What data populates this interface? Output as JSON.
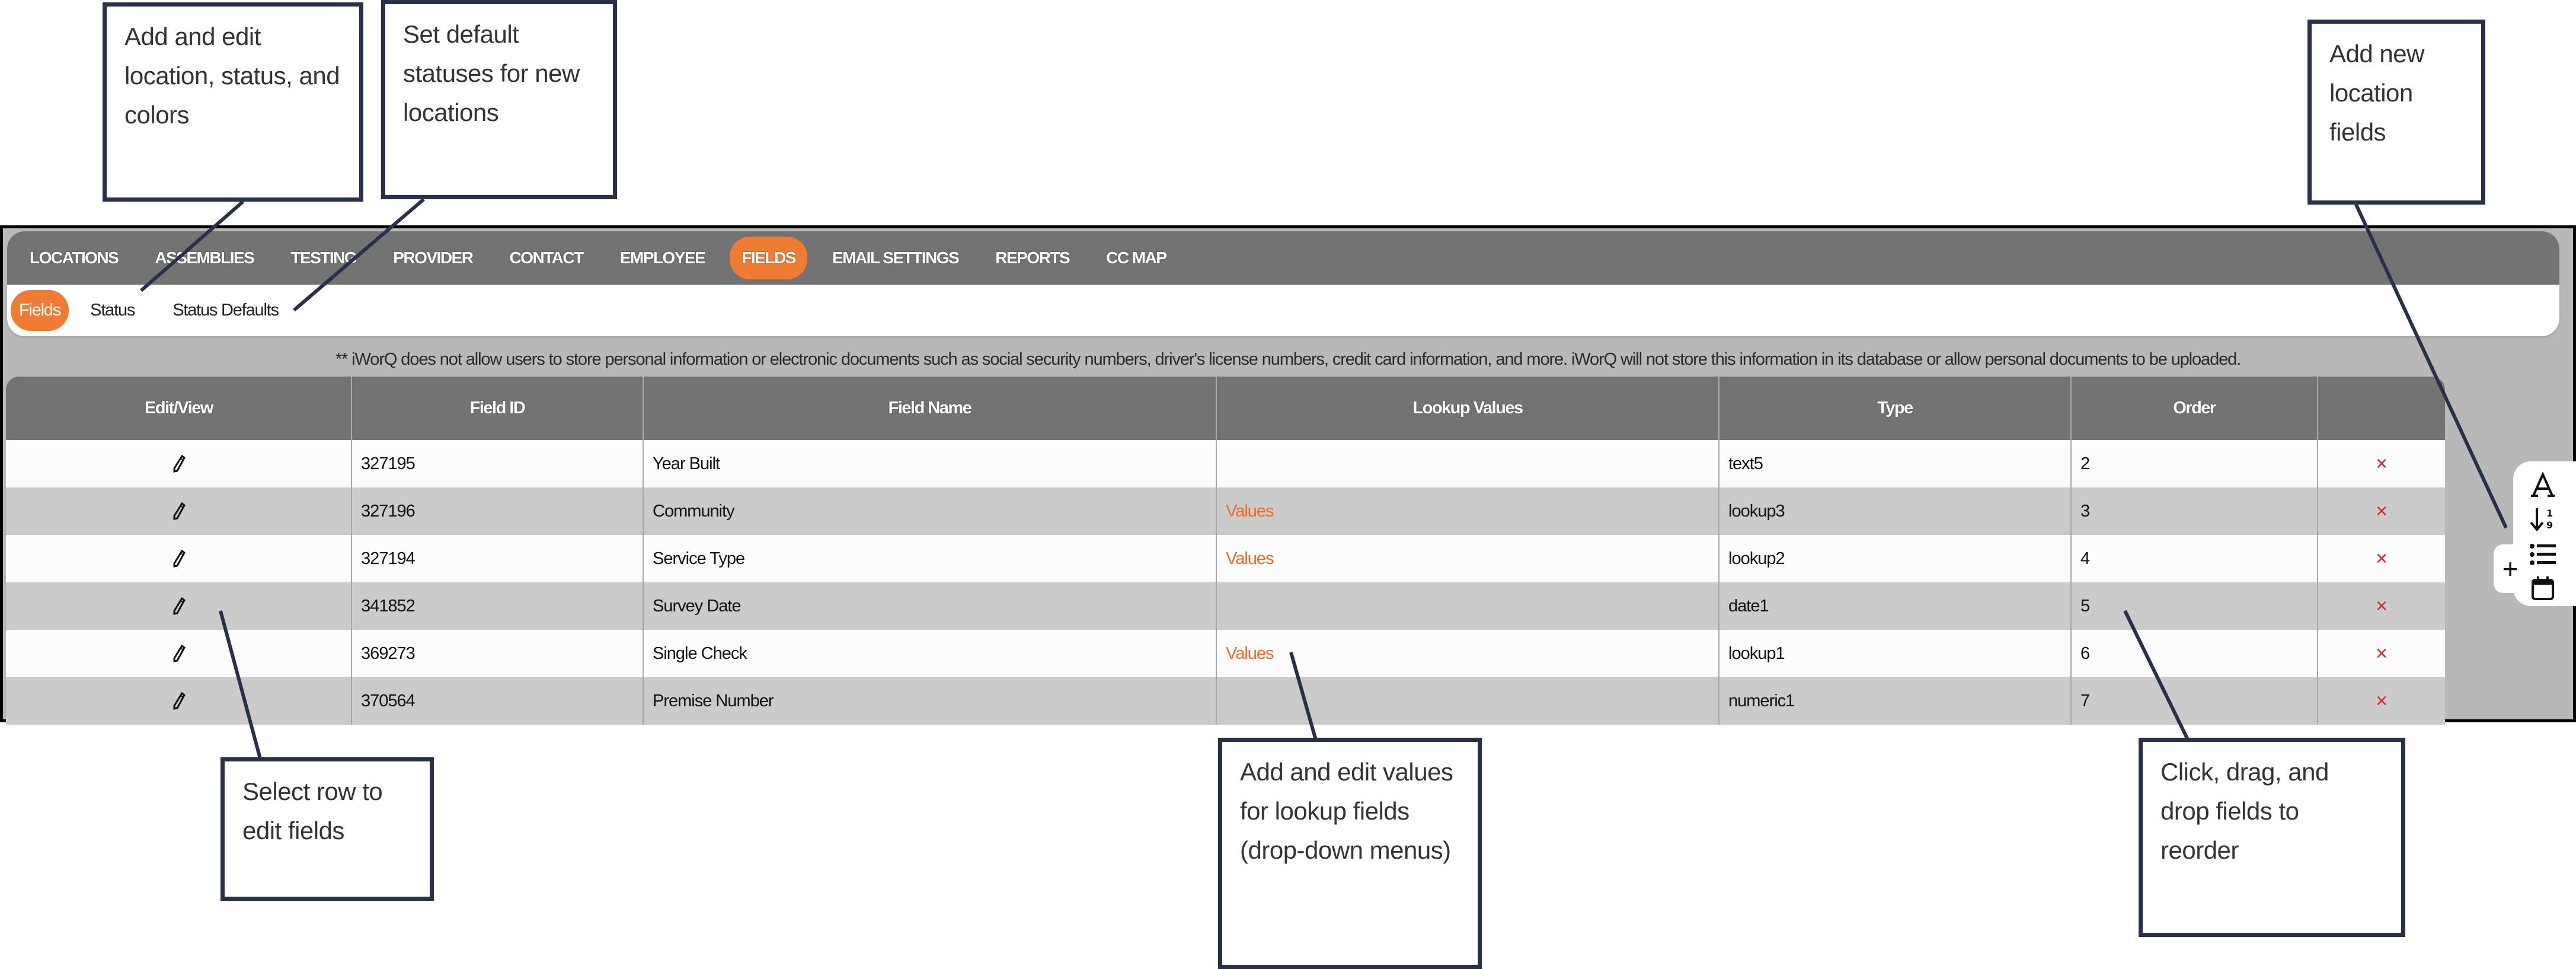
{
  "top_nav": {
    "items": [
      {
        "label": "LOCATIONS",
        "active": false
      },
      {
        "label": "ASSEMBLIES",
        "active": false
      },
      {
        "label": "TESTING",
        "active": false
      },
      {
        "label": "PROVIDER",
        "active": false
      },
      {
        "label": "CONTACT",
        "active": false
      },
      {
        "label": "EMPLOYEE",
        "active": false
      },
      {
        "label": "FIELDS",
        "active": true
      },
      {
        "label": "EMAIL SETTINGS",
        "active": false
      },
      {
        "label": "REPORTS",
        "active": false
      },
      {
        "label": "CC MAP",
        "active": false
      }
    ]
  },
  "sub_nav": {
    "items": [
      {
        "label": "Fields",
        "active": true
      },
      {
        "label": "Status",
        "active": false
      },
      {
        "label": "Status Defaults",
        "active": false
      }
    ]
  },
  "notice": "** iWorQ does not allow users to store personal information or electronic documents such as social security numbers, driver's license numbers, credit card information, and more. iWorQ will not store this information in its database or allow personal documents to be uploaded.",
  "table": {
    "columns": [
      "Edit/View",
      "Field ID",
      "Field Name",
      "Lookup Values",
      "Type",
      "Order",
      ""
    ],
    "rows": [
      {
        "field_id": "327195",
        "field_name": "Year Built",
        "lookup": "",
        "type": "text5",
        "order": "2",
        "delete": "×"
      },
      {
        "field_id": "327196",
        "field_name": "Community",
        "lookup": "Values",
        "type": "lookup3",
        "order": "3",
        "delete": "×"
      },
      {
        "field_id": "327194",
        "field_name": "Service Type",
        "lookup": "Values",
        "type": "lookup2",
        "order": "4",
        "delete": "×"
      },
      {
        "field_id": "341852",
        "field_name": "Survey Date",
        "lookup": "",
        "type": "date1",
        "order": "5",
        "delete": "×"
      },
      {
        "field_id": "369273",
        "field_name": "Single Check",
        "lookup": "Values",
        "type": "lookup1",
        "order": "6",
        "delete": "×"
      },
      {
        "field_id": "370564",
        "field_name": "Premise Number",
        "lookup": "",
        "type": "numeric1",
        "order": "7",
        "delete": "×"
      }
    ]
  },
  "toolbar": {
    "add_label": "+",
    "icons": [
      {
        "name": "text-field-icon",
        "glyph": "A"
      },
      {
        "name": "numeric-sort-icon",
        "glyph": "↓⁹"
      },
      {
        "name": "list-icon",
        "glyph": "☰"
      },
      {
        "name": "calendar-icon",
        "glyph": "▭"
      }
    ]
  },
  "callouts": {
    "locations_status": "Add and edit location, status, and colors",
    "status_defaults": "Set default statuses for new locations",
    "add_fields": "Add new location fields",
    "select_row": "Select row to edit fields",
    "lookup_values": "Add and edit values for lookup fields (drop-down menus)",
    "reorder": "Click, drag, and drop fields to reorder"
  },
  "colors": {
    "accent": "#f07b33",
    "nav_bg": "#737373",
    "link": "#f06a2a",
    "delete": "#e0242e",
    "callout_border": "#283148"
  }
}
